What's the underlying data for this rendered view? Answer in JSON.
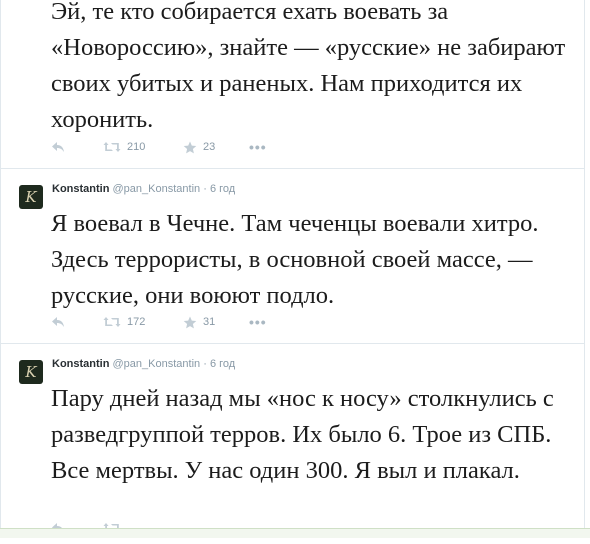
{
  "tweets": [
    {
      "text": "Эй, те кто собирается ехать воевать за «Новороссию», знайте — «русские» не забирают своих убитых и раненых. Нам приходится их хоронить.",
      "retweets": "210",
      "favorites": "23"
    },
    {
      "avatar_letter": "K",
      "name": "Konstantin",
      "handle": "@pan_Konstantin",
      "separator": "·",
      "time": "6 год",
      "text": "Я воевал в Чечне. Там чеченцы воевали хитро. Здесь террористы, в основной своей массе, — русские, они воюют подло.",
      "retweets": "172",
      "favorites": "31"
    },
    {
      "avatar_letter": "K",
      "name": "Konstantin",
      "handle": "@pan_Konstantin",
      "separator": "·",
      "time": "6 год",
      "text": "Пару дней назад мы «нос к носу» столкнулись с разведгруппой терров. Их было 6. Трое из СПБ. Все мертвы. У нас один 300. Я выл и плакал."
    }
  ],
  "icons": {
    "reply": "reply-icon",
    "retweet": "retweet-icon",
    "favorite": "star-icon",
    "more": "more-icon"
  },
  "colors": {
    "action_icon": "#c2cdd5",
    "meta_text": "#8899a6",
    "tweet_text": "#1c1c1c"
  }
}
